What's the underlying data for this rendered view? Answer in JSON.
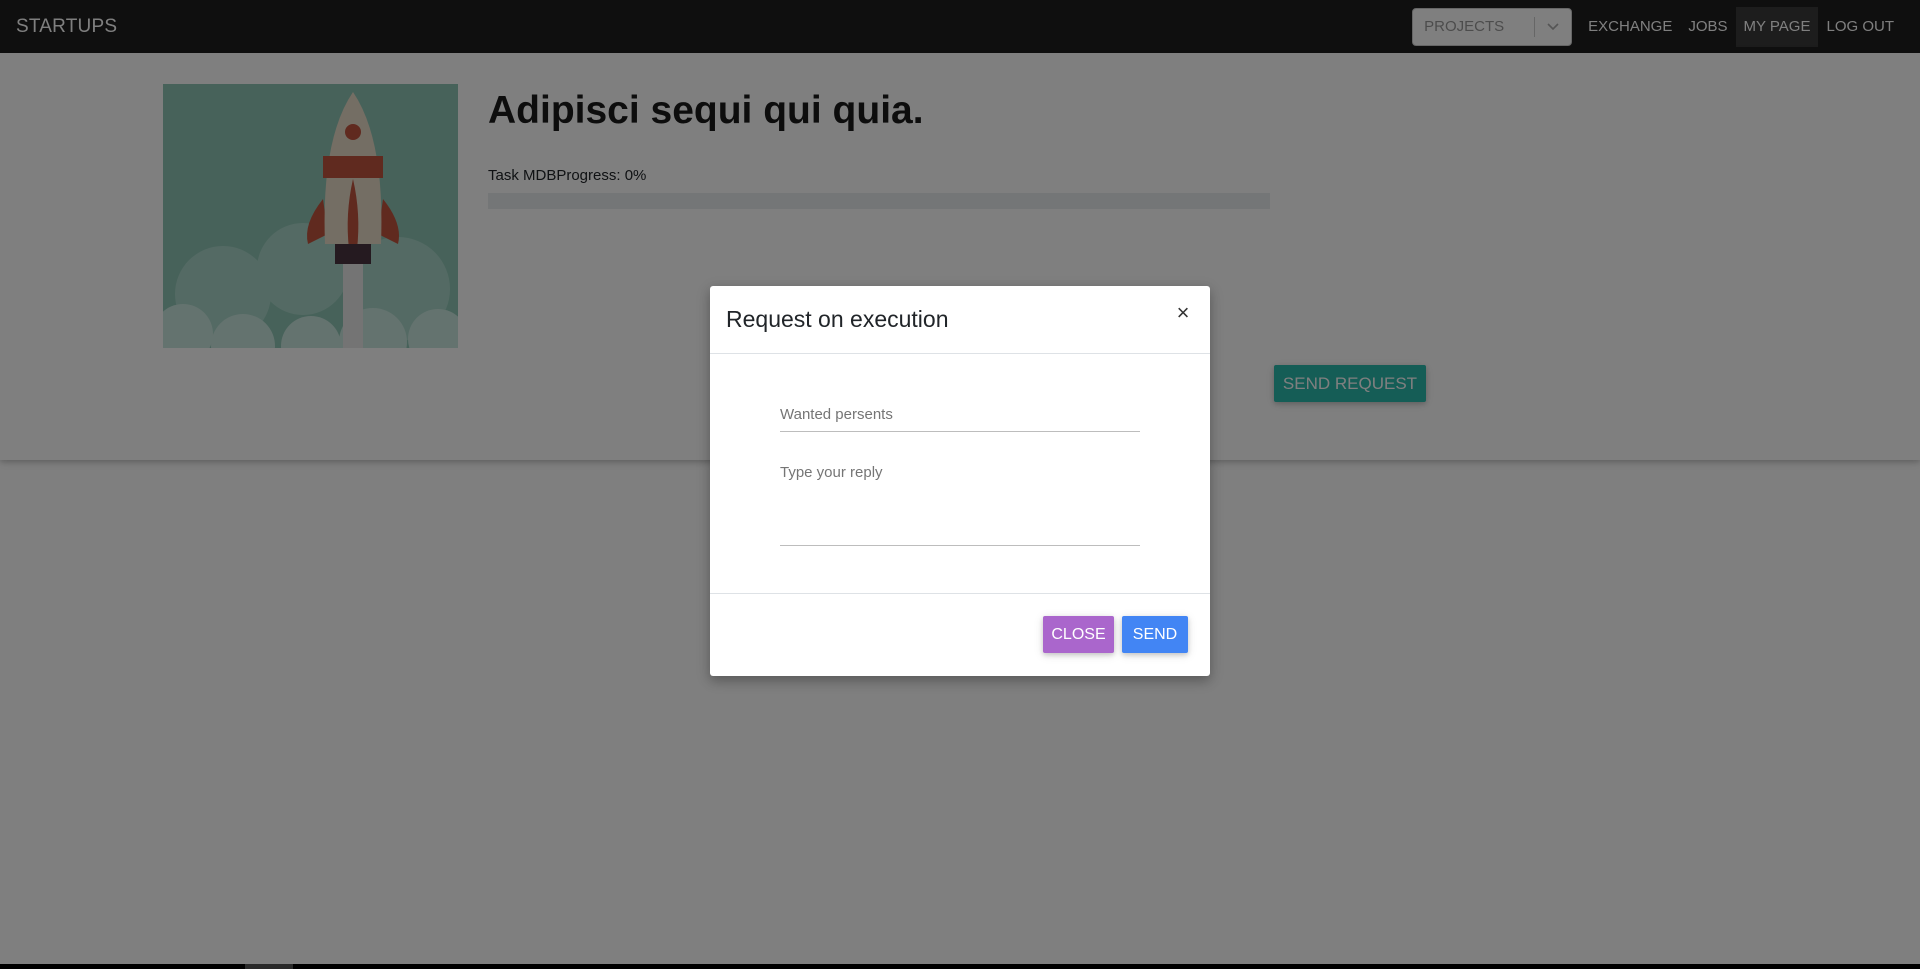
{
  "navbar": {
    "brand": "STARTUPS",
    "projects_select": {
      "selected": "PROJECTS"
    },
    "links": [
      {
        "label": "EXCHANGE"
      },
      {
        "label": "JOBS"
      },
      {
        "label": "MY PAGE",
        "active": true
      },
      {
        "label": "LOG OUT"
      }
    ]
  },
  "project": {
    "title": "Adipisci sequi qui quia.",
    "progress_label": "Task MDBProgress: 0%",
    "progress_value": 0,
    "send_request_label": "SEND REQUEST"
  },
  "modal": {
    "title": "Request on execution",
    "close_icon": "×",
    "persons_placeholder": "Wanted persents",
    "reply_placeholder": "Type your reply",
    "close_label": "CLOSE",
    "send_label": "SEND"
  },
  "colors": {
    "navbar_bg": "#1f1f1f",
    "send_request": "#2bbbad",
    "close_button": "#aa66cc",
    "send_button": "#4285f4"
  }
}
